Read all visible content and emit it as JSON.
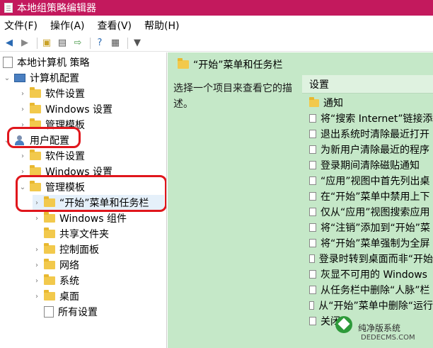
{
  "window": {
    "title": "本地组策略编辑器",
    "accent": "#c3195d"
  },
  "menu": [
    "文件(F)",
    "操作(A)",
    "查看(V)",
    "帮助(H)"
  ],
  "toolbar_icons": [
    "back-icon",
    "forward-icon",
    "up-folder-icon",
    "show-hide-tree-icon",
    "export-icon",
    "help-icon",
    "properties-icon",
    "filter-icon"
  ],
  "tree": {
    "root": "本地计算机 策略",
    "computer_config": "计算机配置",
    "computer_children": [
      "软件设置",
      "Windows 设置",
      "管理模板"
    ],
    "user_config": "用户配置",
    "user_children": [
      "软件设置",
      "Windows 设置",
      "管理模板"
    ],
    "admin_templates_children": [
      "“开始”菜单和任务栏",
      "Windows 组件",
      "共享文件夹",
      "控制面板",
      "网络",
      "系统",
      "桌面",
      "所有设置"
    ]
  },
  "right": {
    "header": "“开始”菜单和任务栏",
    "description": "选择一个项目来查看它的描述。",
    "column": "设置",
    "items": [
      "通知",
      "将“搜索 Internet”链接添",
      "退出系统时清除最近打开",
      "为新用户清除最近的程序",
      "登录期间清除磁贴通知",
      "“应用”视图中首先列出桌",
      "在“开始”菜单中禁用上下",
      "仅从“应用”视图搜索应用",
      "将“注销”添加到“开始”菜",
      "将“开始”菜单强制为全屏",
      "登录时转到桌面而非“开始",
      "灰显不可用的 Windows",
      "从任务栏中删除“人脉”栏",
      "从“开始”菜单中删除“运行",
      "关闭"
    ]
  },
  "watermark": {
    "text": "纯净版系统",
    "site": "DEDECMS.COM"
  },
  "highlight_color": "#e0161c"
}
